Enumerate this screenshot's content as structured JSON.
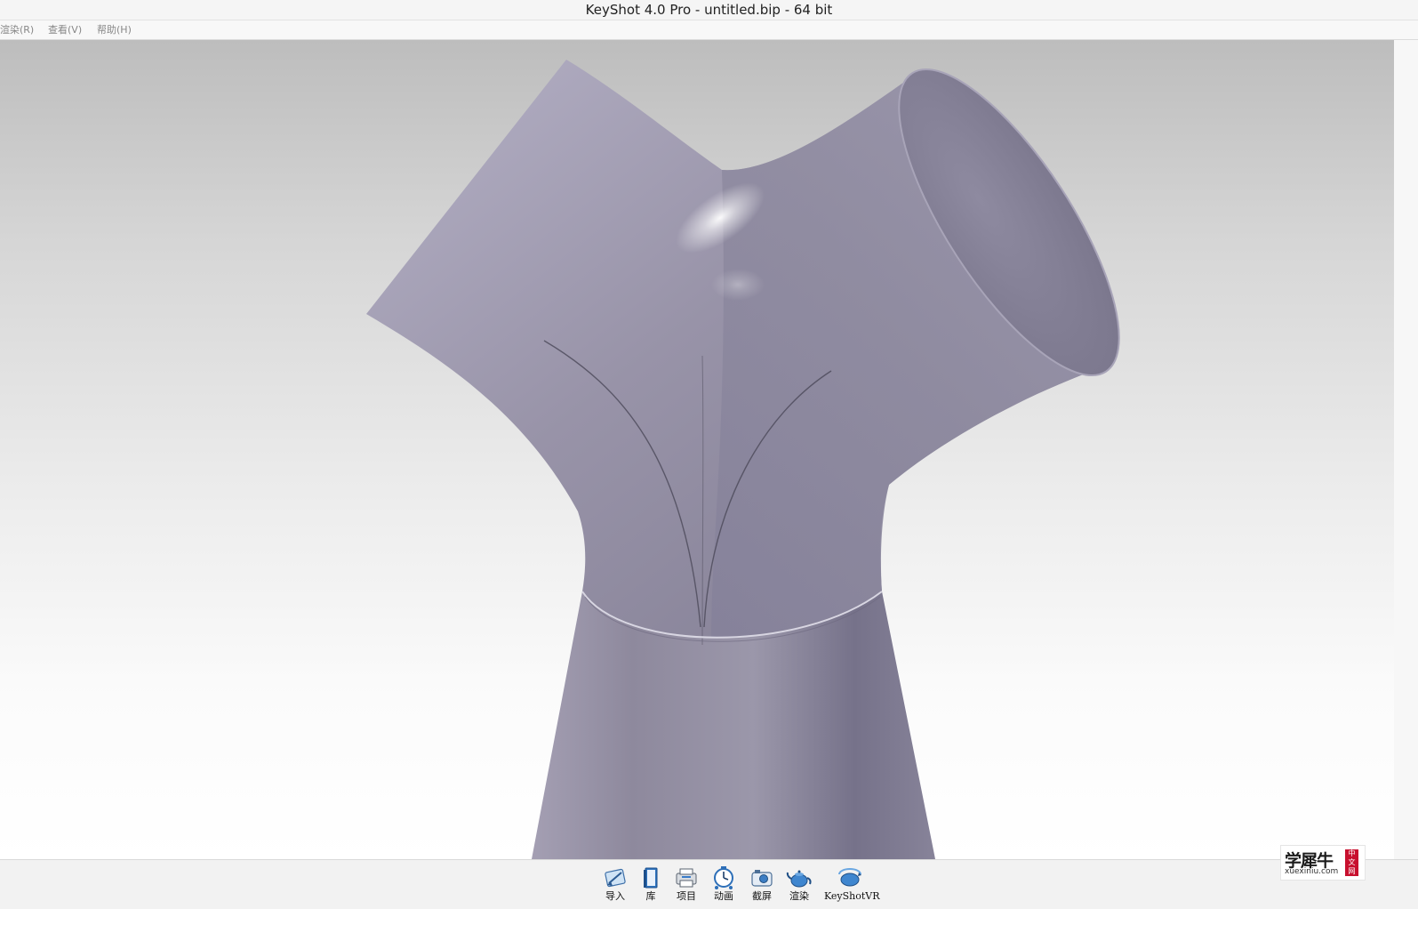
{
  "window": {
    "title": "KeyShot 4.0 Pro  - untitled.bip  - 64 bit"
  },
  "menu": {
    "items": [
      {
        "label": "渲染(R)"
      },
      {
        "label": "查看(V)"
      },
      {
        "label": "帮助(H)"
      }
    ]
  },
  "toolbar": {
    "items": [
      {
        "label": "导入",
        "icon": "import-icon"
      },
      {
        "label": "库",
        "icon": "library-icon"
      },
      {
        "label": "项目",
        "icon": "project-icon"
      },
      {
        "label": "动画",
        "icon": "animation-icon"
      },
      {
        "label": "截屏",
        "icon": "screenshot-icon"
      },
      {
        "label": "渲染",
        "icon": "render-teapot-icon"
      },
      {
        "label": "KeyShotVR",
        "icon": "keyshotvr-icon"
      }
    ]
  },
  "watermark": {
    "title": "学犀牛",
    "url": "xuexiniu.com",
    "tag": "中文网"
  },
  "colors": {
    "model": "#938fa3",
    "background_top": "#bdbdbd",
    "background_bottom": "#ffffff"
  }
}
